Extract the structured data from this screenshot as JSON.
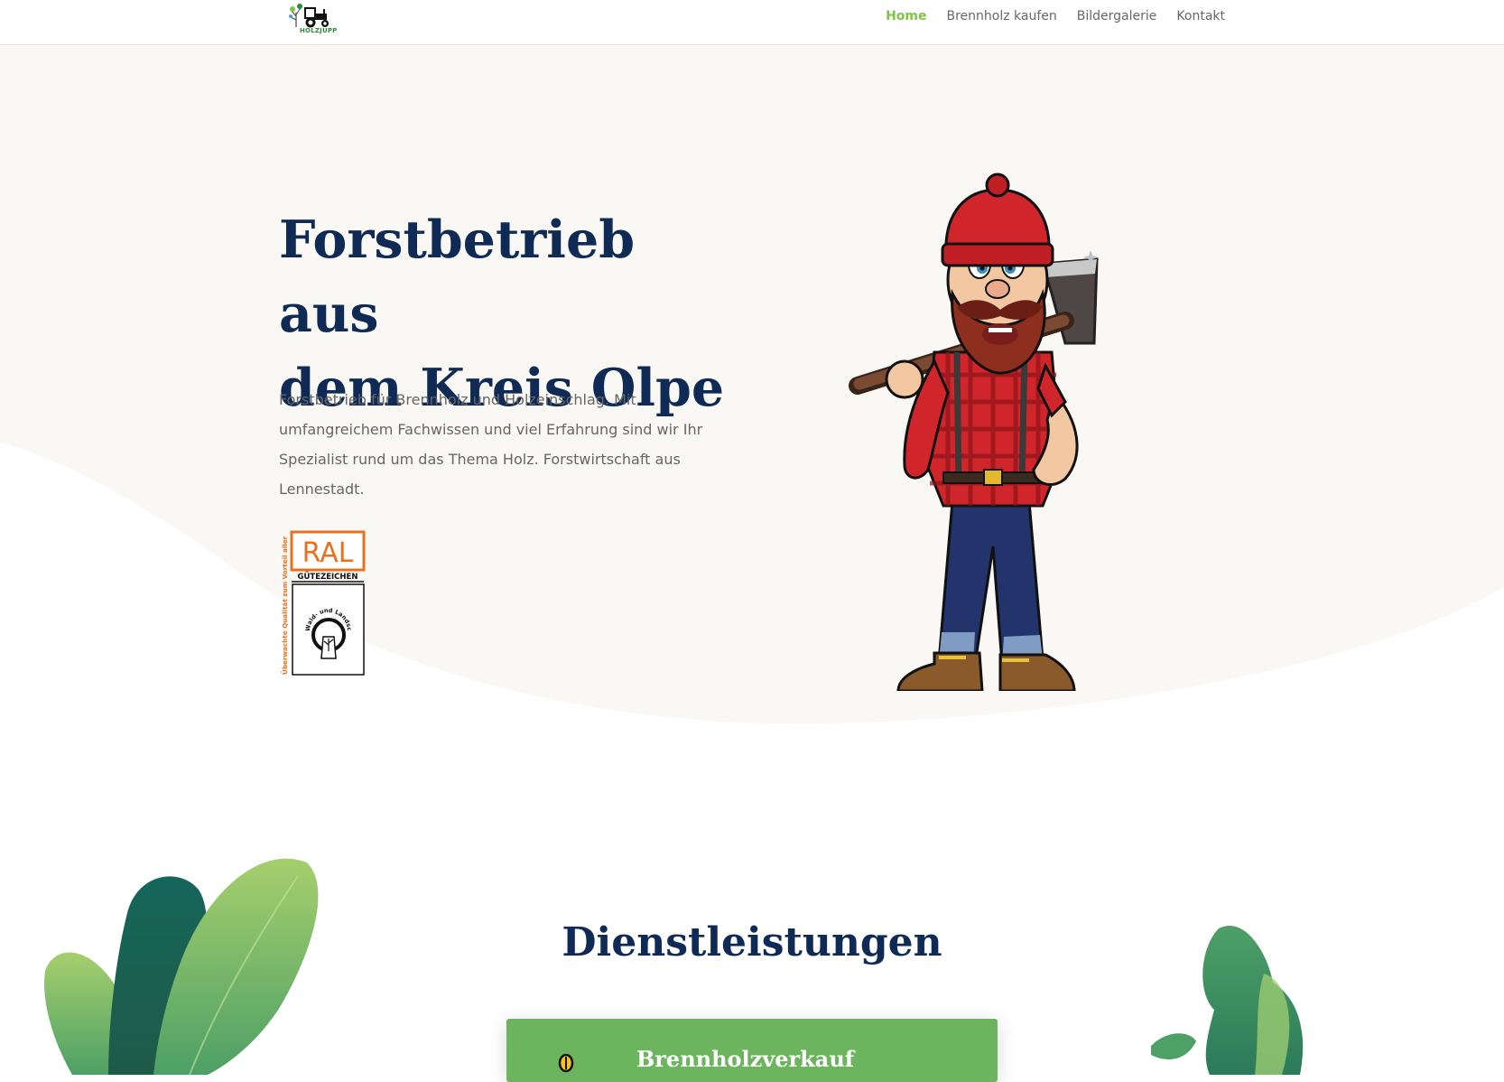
{
  "header": {
    "logo_text": "HOLZJUPP",
    "nav": [
      {
        "label": "Home",
        "active": true
      },
      {
        "label": "Brennholz kaufen",
        "active": false
      },
      {
        "label": "Bildergalerie",
        "active": false
      },
      {
        "label": "Kontakt",
        "active": false
      }
    ]
  },
  "hero": {
    "title_line1": "Forstbetrieb aus",
    "title_line2": "dem Kreis Olpe",
    "description": "Forstbetrieb für Brennholz und Holzeinschlag. Mit umfangreichem Fachwissen und viel Erfahrung sind wir Ihr Spezialist rund um das Thema Holz. Forstwirtschaft aus Lennestadt.",
    "ral_badge": {
      "top": "RAL",
      "middle": "GÜTEZEICHEN",
      "side": "Überwachte Qualität zum Vorteil aller",
      "ring": "Wald- und Landschaftspflege"
    }
  },
  "services": {
    "title": "Dienstleistungen",
    "cards": [
      {
        "label": "Brennholzverkauf"
      }
    ]
  },
  "colors": {
    "accent_green": "#7cc644",
    "heading_navy": "#0e2a55",
    "card_green": "#6cb55e",
    "hero_bg": "#f9f8f4",
    "ral_orange": "#e8701f"
  }
}
